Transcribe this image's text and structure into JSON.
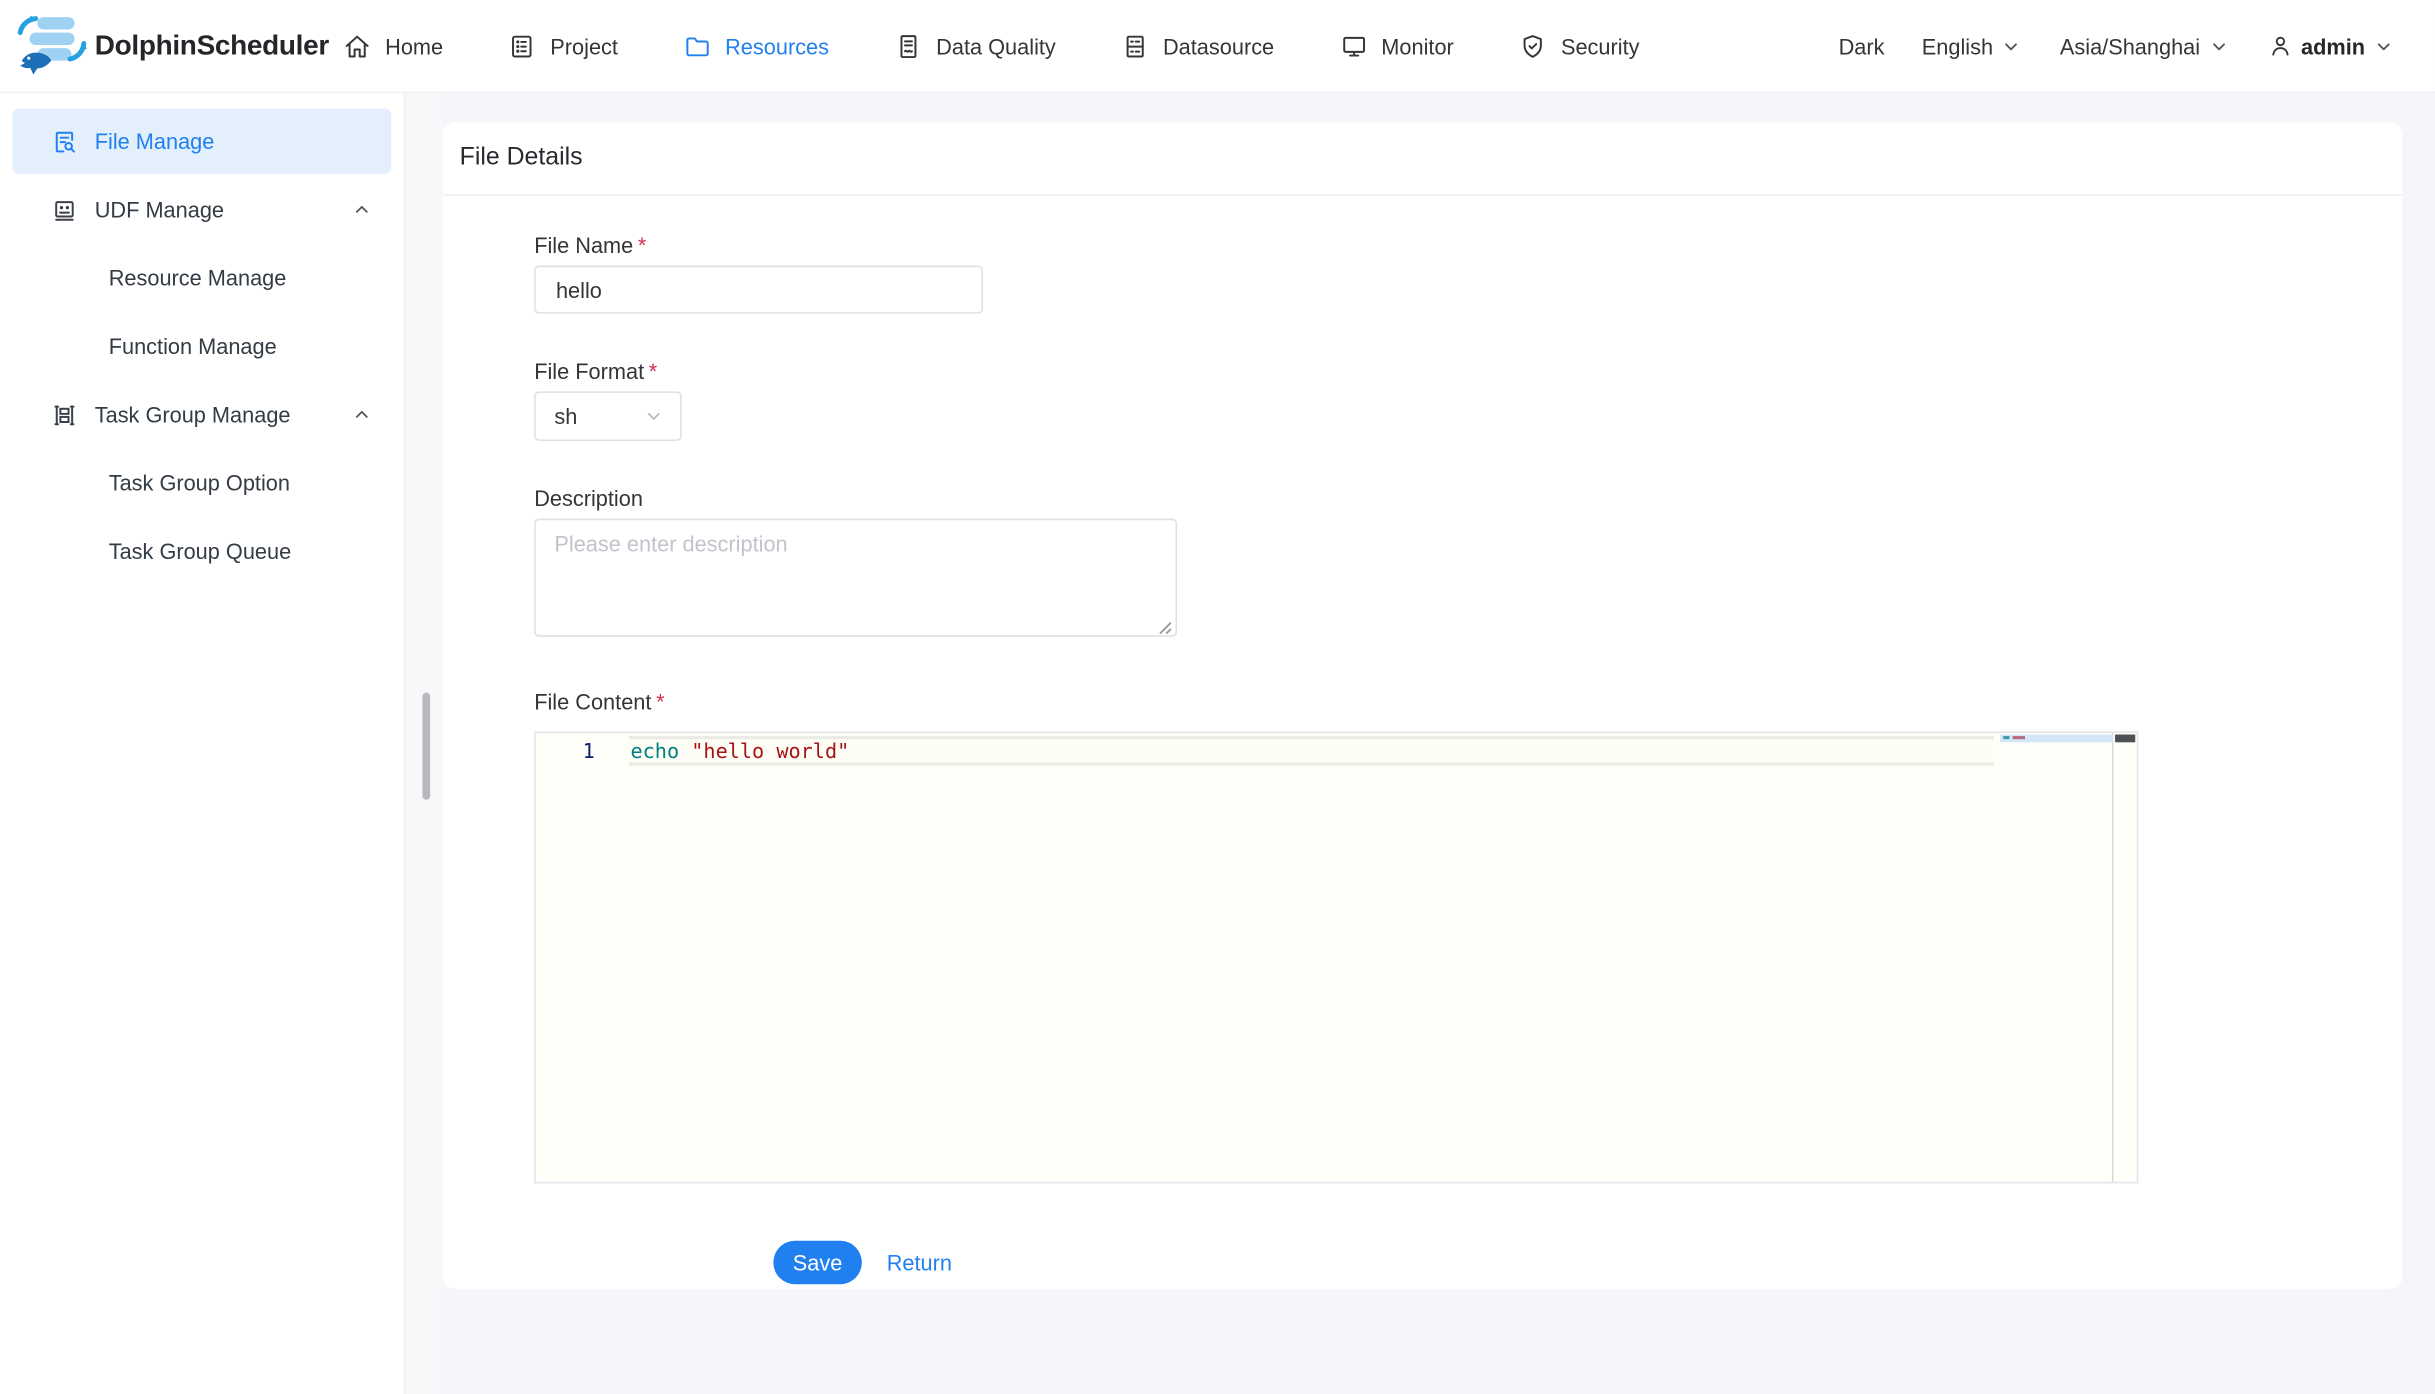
{
  "brand": {
    "name": "DolphinScheduler"
  },
  "topnav": {
    "items": [
      {
        "label": "Home",
        "icon": "home-icon",
        "active": false
      },
      {
        "label": "Project",
        "icon": "project-icon",
        "active": false
      },
      {
        "label": "Resources",
        "icon": "folder-icon",
        "active": true
      },
      {
        "label": "Data Quality",
        "icon": "data-quality-icon",
        "active": false
      },
      {
        "label": "Datasource",
        "icon": "datasource-icon",
        "active": false
      },
      {
        "label": "Monitor",
        "icon": "monitor-icon",
        "active": false
      },
      {
        "label": "Security",
        "icon": "security-shield-icon",
        "active": false
      }
    ],
    "right": {
      "theme_label": "Dark",
      "language": "English",
      "timezone": "Asia/Shanghai",
      "user": "admin"
    }
  },
  "sidebar": {
    "items": [
      {
        "label": "File Manage",
        "icon": "file-search-icon",
        "active": true
      },
      {
        "label": "UDF Manage",
        "icon": "udf-icon",
        "expanded": true
      },
      {
        "label": "Resource Manage"
      },
      {
        "label": "Function Manage"
      },
      {
        "label": "Task Group Manage",
        "icon": "task-group-icon",
        "expanded": true
      },
      {
        "label": "Task Group Option"
      },
      {
        "label": "Task Group Queue"
      }
    ]
  },
  "page": {
    "card_title": "File Details",
    "form": {
      "file_name": {
        "label": "File Name",
        "required": "*",
        "value": "hello"
      },
      "file_format": {
        "label": "File Format",
        "required": "*",
        "value": "sh"
      },
      "description": {
        "label": "Description",
        "value": "",
        "placeholder": "Please enter description"
      },
      "file_content": {
        "label": "File Content",
        "required": "*",
        "lines": [
          {
            "number": "1",
            "tokens": [
              {
                "text": "echo",
                "color": "#008080"
              },
              {
                "text": " ",
                "color": "#333333"
              },
              {
                "text": "\"hello world\"",
                "color": "#a31515"
              }
            ]
          }
        ]
      }
    },
    "buttons": {
      "save": "Save",
      "return": "Return"
    }
  },
  "colors": {
    "primary": "#2080f0",
    "active_menu_bg": "#e4effc",
    "page_bg": "#f5f6f9",
    "editor_bg": "#fffef8",
    "line_number": "#0b216f",
    "required_asterisk": "#d03050",
    "save_button_bg": "#2080f0",
    "minimap_slider": "#d3e6f8",
    "cursor_marker": "#4d4f52"
  }
}
